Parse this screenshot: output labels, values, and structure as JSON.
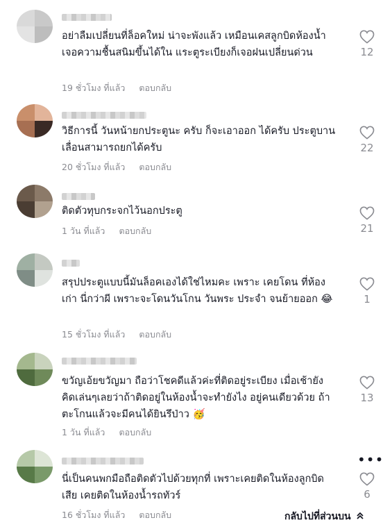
{
  "comments": [
    {
      "text": "อย่าลืมเปลี่ยนที่ล็อคใหม่ น่าจะพังแล้ว เหมือนเคสลูกบิดห้องน้ำเจอความชื้นสนิมขึ้นได้ใน แระตูระเบียงก็เจอฝนเปลี่ยนด่วน",
      "time": "19 ชั่วโมง ที่แล้ว",
      "reply": "ตอบกลับ",
      "likes": "12",
      "avatar_colors": [
        "#d9d9d9",
        "#c9c9c9",
        "#e3e3e3",
        "#bdbdbd"
      ]
    },
    {
      "text": "วิธีการนี้ วันหน้ายกประตูนะ ครับ ก็จะเอาออก ได้ครับ ประตูบานเลื่อนสามารถยกได้ครับ",
      "time": "20 ชั่วโมง ที่แล้ว",
      "reply": "ตอบกลับ",
      "likes": "22",
      "avatar_colors": [
        "#c98f6b",
        "#3a2a25",
        "#a76f52",
        "#e2b49a"
      ]
    },
    {
      "text": "ติดตัวทุบกระจกไว้นอกประตู",
      "time": "1 วัน ที่แล้ว",
      "reply": "ตอบกลับ",
      "likes": "21",
      "avatar_colors": [
        "#6b5a4b",
        "#8c7a69",
        "#4a3d33",
        "#b1a18f"
      ]
    },
    {
      "text": "สรุปประตูแบบนี้มันล็อคเองได้ใช่ไหมคะ เพราะ เคยโดน ที่ห้องเก่า นี่กว่าผี เพราะจะโดนวันโกน วันพระ ประจำ จนย้ายออก 😂",
      "time": "15 ชั่วโมง ที่แล้ว",
      "reply": "ตอบกลับ",
      "likes": "1",
      "avatar_colors": [
        "#9fb0a3",
        "#c4c9c2",
        "#7f8d86",
        "#dfe3df"
      ]
    },
    {
      "text": "ขวัญเอ้ยขวัญมา ถือว่าโชคดีแล้วค่ะที่ติดอยู่ระเบียง เมื่อเช้ายังคิดเล่นๆเลยว่าถ้าติดอยู่ในห้องน้ำจะทำยังไง อยู่คนเดียวด้วย ถ้าตะโกนแล้วจะมีคนได้ยินรึป่าว 🥳",
      "time": "1 วัน ที่แล้ว",
      "reply": "ตอบกลับ",
      "likes": "13",
      "avatar_colors": [
        "#6f8a5a",
        "#a4b88e",
        "#4f6b3e",
        "#c9d3bd"
      ]
    },
    {
      "text": "นี่เป็นคนพกมือถือติดตัวไปด้วยทุกที่ เพราะเคยติดในห้องลูกบิดเสีย เคยติดในห้องน้ำรถทัวร์",
      "time": "16 ชั่วโมง ที่แล้ว",
      "reply": "ตอบกลับ",
      "likes": "6",
      "avatar_colors": [
        "#7a9a6a",
        "#b6c9a8",
        "#587a48",
        "#dde5d6"
      ]
    }
  ],
  "back_to_top": "กลับไปที่ส่วนบน",
  "icons": {
    "like": "heart-outline-icon",
    "more": "more-dots-icon",
    "back_top": "chevron-double-up-icon"
  }
}
